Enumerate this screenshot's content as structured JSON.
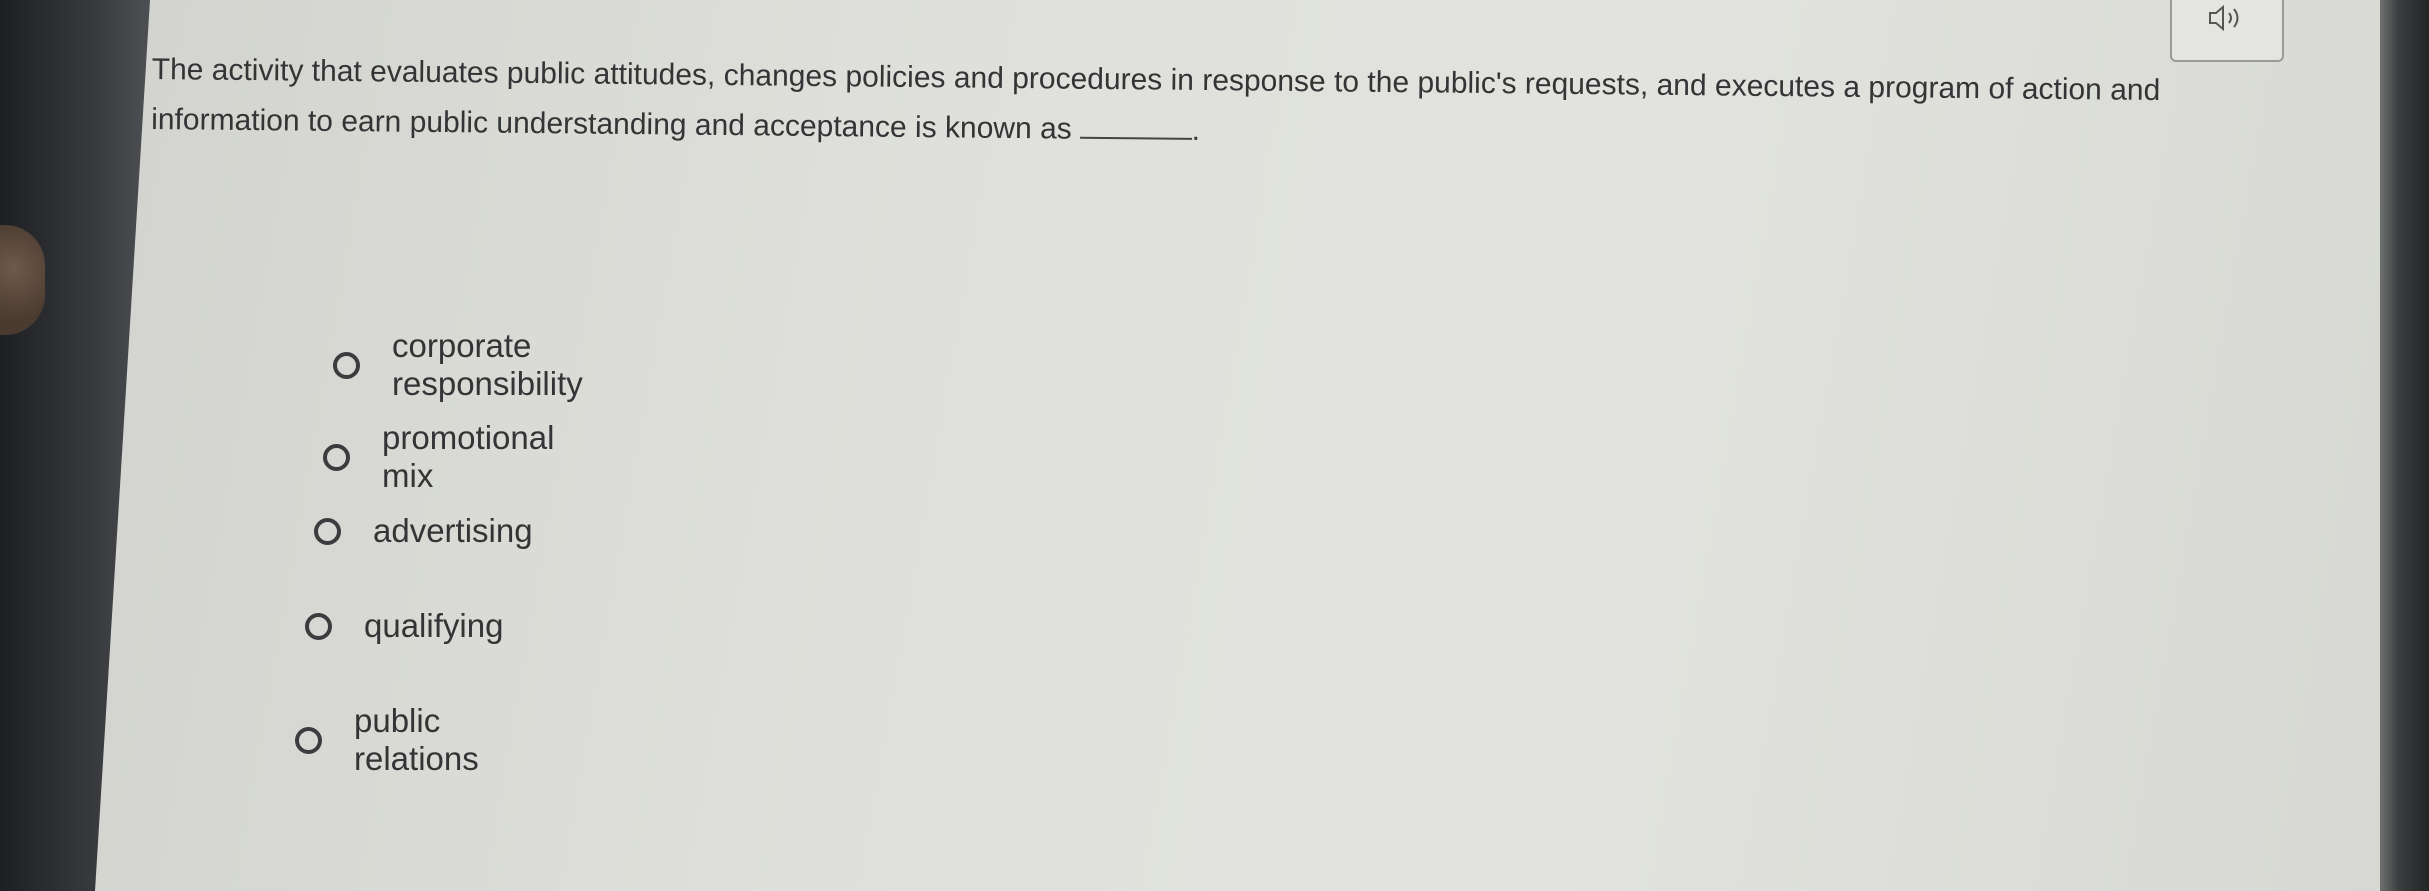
{
  "question": {
    "text": "The activity that evaluates public attitudes, changes policies and procedures in response to the public's requests, and executes a program of action and information to earn public understanding and acceptance is known as",
    "end_punctuation": "."
  },
  "audio": {
    "icon": "speaker-icon"
  },
  "options": [
    {
      "label": "corporate responsibility",
      "selected": false
    },
    {
      "label": "promotional mix",
      "selected": false
    },
    {
      "label": "advertising",
      "selected": false
    },
    {
      "label": "qualifying",
      "selected": false
    },
    {
      "label": "public relations",
      "selected": false
    }
  ]
}
